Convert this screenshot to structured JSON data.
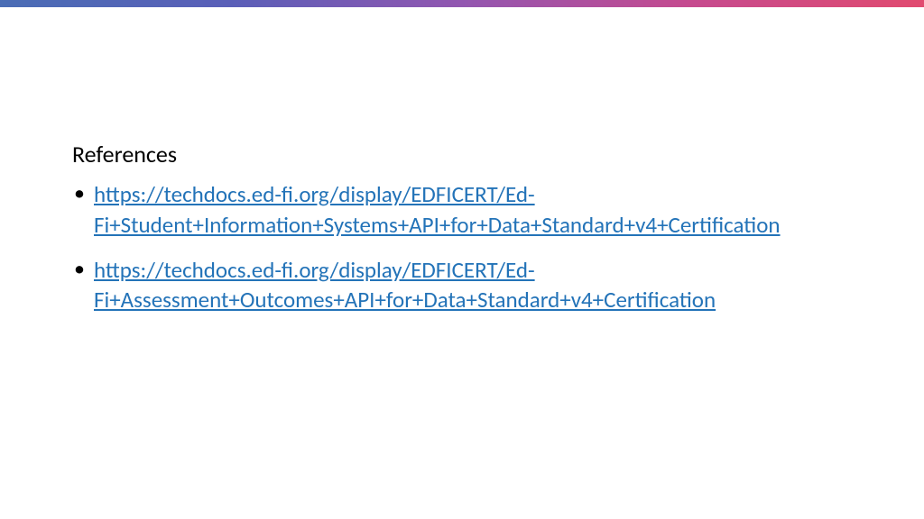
{
  "heading": "References",
  "references": [
    {
      "url": "https://techdocs.ed-fi.org/display/EDFICERT/Ed-Fi+Student+Information+Systems+API+for+Data+Standard+v4+Certification"
    },
    {
      "url": "https://techdocs.ed-fi.org/display/EDFICERT/Ed-Fi+Assessment+Outcomes+API+for+Data+Standard+v4+Certification"
    }
  ]
}
